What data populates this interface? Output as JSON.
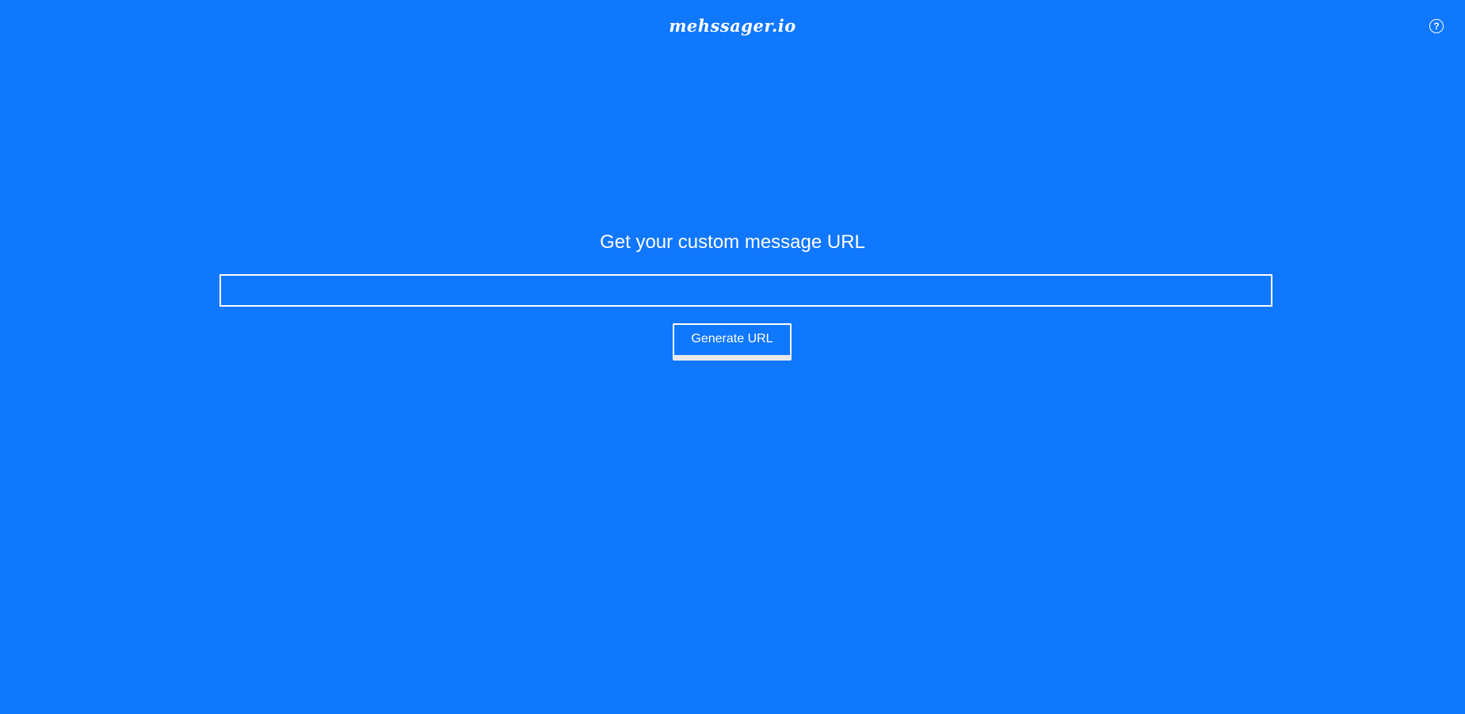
{
  "header": {
    "logo_text": "mehssager.io",
    "help_icon": "question-circle-icon",
    "help_glyph": "?"
  },
  "main": {
    "heading": "Get your custom message URL",
    "url_input": {
      "value": "",
      "placeholder": ""
    },
    "generate_button_label": "Generate URL"
  },
  "colors": {
    "background": "#1077ff",
    "foreground": "#ffffff",
    "button_shadow": "#e9e9ec"
  }
}
